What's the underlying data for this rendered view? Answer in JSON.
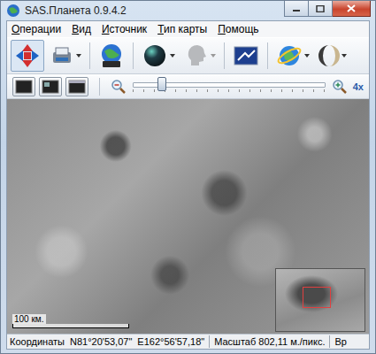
{
  "window": {
    "title": "SAS.Планета 0.9.4.2"
  },
  "menu": [
    "Операции",
    "Вид",
    "Источник",
    "Тип карты",
    "Помощь"
  ],
  "toolbar": {
    "move_tool_selected": true
  },
  "zoom": {
    "level": 0.15,
    "label": "4x"
  },
  "map": {
    "scale_label": "100 км."
  },
  "status_bar": {
    "coordinates_label": "Координаты",
    "lat": "N81°20'53,07\"",
    "lon": "E162°56'57,18\"",
    "scale": "Масштаб 802,11 м./пикс.",
    "time": "Вр"
  }
}
